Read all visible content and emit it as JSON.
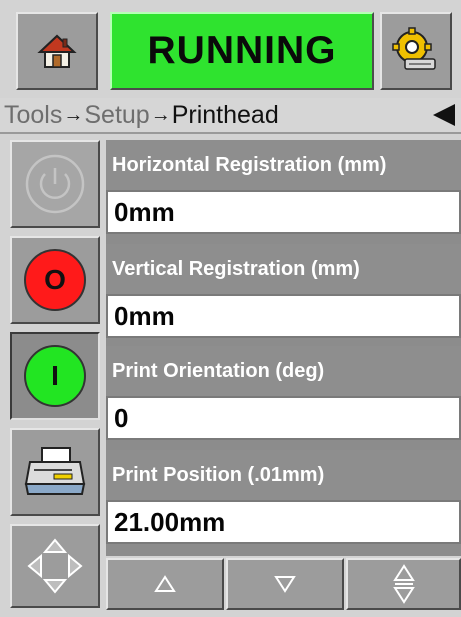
{
  "header": {
    "status": "RUNNING",
    "status_color": "#2fe32f"
  },
  "breadcrumb": {
    "items": [
      "Tools",
      "Setup"
    ],
    "current": "Printhead",
    "separator": "→"
  },
  "left_buttons": {
    "stop_label": "O",
    "start_label": "I",
    "stop_color": "#ff1a1a",
    "start_color": "#22e522"
  },
  "parameters": [
    {
      "label": "Horizontal Registration (mm)",
      "value": "0mm"
    },
    {
      "label": "Vertical Registration (mm)",
      "value": "0mm"
    },
    {
      "label": "Print Orientation (deg)",
      "value": "0"
    },
    {
      "label": "Print Position (.01mm)",
      "value": "21.00mm"
    }
  ],
  "icons": {
    "home": "home-icon",
    "settings": "settings-gear-icon",
    "power": "power-icon",
    "printer": "printer-icon",
    "navigate": "navigate-arrows-icon",
    "back": "back-arrow-icon",
    "up": "up-arrow-icon",
    "down": "down-arrow-icon",
    "up_down": "up-down-arrow-icon"
  }
}
